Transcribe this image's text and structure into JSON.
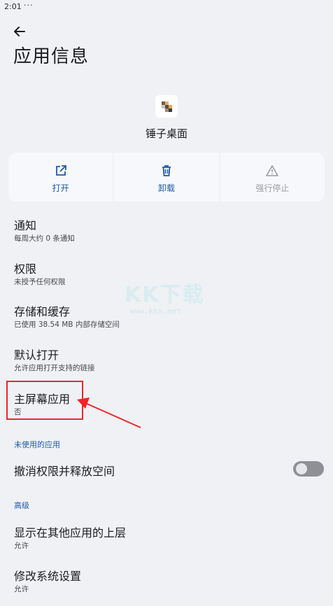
{
  "status_bar": {
    "time": "2:01",
    "dots": "···"
  },
  "header": {
    "title": "应用信息"
  },
  "app": {
    "name": "锤子桌面"
  },
  "actions": [
    {
      "label": "打开",
      "icon": "open-in-new-icon",
      "enabled": true
    },
    {
      "label": "卸载",
      "icon": "trash-icon",
      "enabled": true
    },
    {
      "label": "强行停止",
      "icon": "warning-icon",
      "enabled": false
    }
  ],
  "items": {
    "notifications": {
      "title": "通知",
      "sub": "每周大约 0 条通知"
    },
    "permissions": {
      "title": "权限",
      "sub": "未授予任何权限"
    },
    "storage": {
      "title": "存储和缓存",
      "sub": "已使用 38.54 MB 内部存储空间"
    },
    "default_open": {
      "title": "默认打开",
      "sub": "允许应用打开支持的链接"
    },
    "home_app": {
      "title": "主屏幕应用",
      "sub": "否"
    }
  },
  "unused_section": {
    "header": "未使用的应用",
    "toggle_label": "撤消权限并释放空间",
    "toggle_on": false
  },
  "advanced_section": {
    "header": "高级",
    "overlay": {
      "title": "显示在其他应用的上层",
      "sub": "允许"
    },
    "modify_settings": {
      "title": "修改系统设置",
      "sub": "允许"
    }
  },
  "watermark": {
    "brand": "KK下载",
    "url": "www.kkx.net"
  },
  "colors": {
    "accent": "#1f5aa6",
    "highlight": "#f0252a",
    "background": "#eff1f5"
  }
}
